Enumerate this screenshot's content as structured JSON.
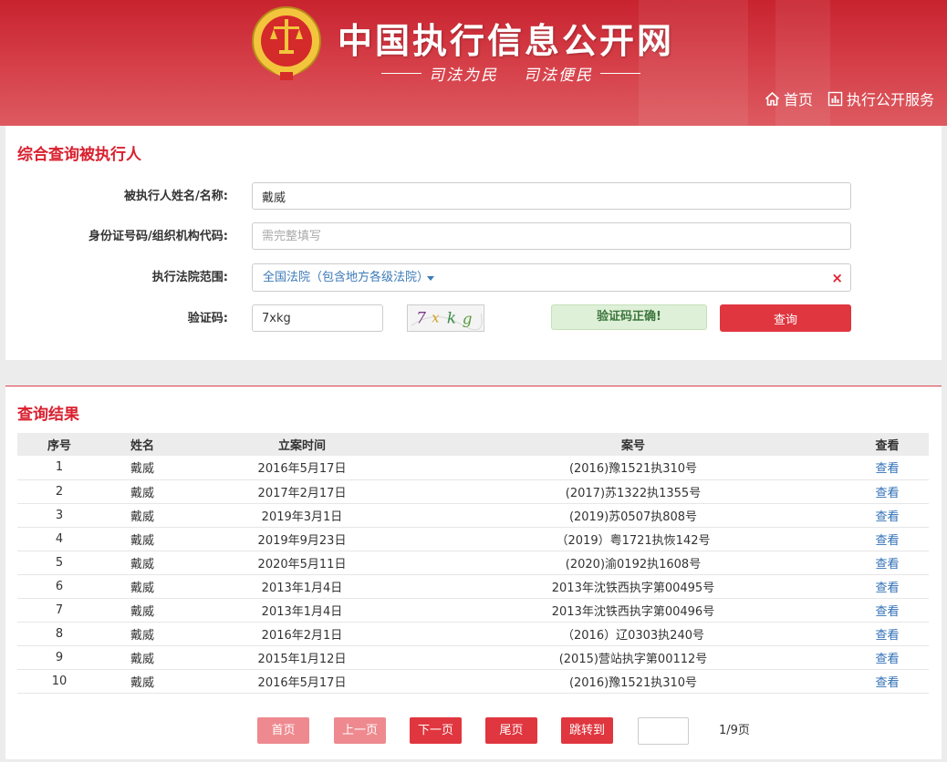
{
  "header": {
    "site_title": "中国执行信息公开网",
    "slogan_left": "司法为民",
    "slogan_right": "司法便民",
    "nav": [
      {
        "label": "首页",
        "icon": "home-icon"
      },
      {
        "label": "执行公开服务",
        "icon": "bar-chart-icon"
      }
    ]
  },
  "search_panel": {
    "title": "综合查询被执行人",
    "fields": {
      "name_label": "被执行人姓名/名称:",
      "name_value": "戴威",
      "id_label": "身份证号码/组织机构代码:",
      "id_placeholder": "需完整填写",
      "court_label": "执行法院范围:",
      "court_value": "全国法院（包含地方各级法院）",
      "captcha_label": "验证码:",
      "captcha_value": "7xkg",
      "captcha_image_text": "7xkg",
      "captcha_status": "验证码正确!",
      "submit_label": "查询"
    }
  },
  "results_panel": {
    "title": "查询结果",
    "columns": [
      "序号",
      "姓名",
      "立案时间",
      "案号",
      "查看"
    ],
    "rows": [
      {
        "no": "1",
        "name": "戴威",
        "date": "2016年5月17日",
        "case": "(2016)豫1521执310号",
        "view": "查看"
      },
      {
        "no": "2",
        "name": "戴威",
        "date": "2017年2月17日",
        "case": "(2017)苏1322执1355号",
        "view": "查看"
      },
      {
        "no": "3",
        "name": "戴威",
        "date": "2019年3月1日",
        "case": "(2019)苏0507执808号",
        "view": "查看"
      },
      {
        "no": "4",
        "name": "戴威",
        "date": "2019年9月23日",
        "case": "（2019）粤1721执恢142号",
        "view": "查看"
      },
      {
        "no": "5",
        "name": "戴威",
        "date": "2020年5月11日",
        "case": "(2020)渝0192执1608号",
        "view": "查看"
      },
      {
        "no": "6",
        "name": "戴威",
        "date": "2013年1月4日",
        "case": "2013年沈铁西执字第00495号",
        "view": "查看"
      },
      {
        "no": "7",
        "name": "戴威",
        "date": "2013年1月4日",
        "case": "2013年沈铁西执字第00496号",
        "view": "查看"
      },
      {
        "no": "8",
        "name": "戴威",
        "date": "2016年2月1日",
        "case": "（2016）辽0303执240号",
        "view": "查看"
      },
      {
        "no": "9",
        "name": "戴威",
        "date": "2015年1月12日",
        "case": "(2015)营站执字第00112号",
        "view": "查看"
      },
      {
        "no": "10",
        "name": "戴威",
        "date": "2016年5月17日",
        "case": "(2016)豫1521执310号",
        "view": "查看"
      }
    ],
    "pagination": {
      "first": "首页",
      "prev": "上一页",
      "next": "下一页",
      "last": "尾页",
      "jump": "跳转到",
      "jump_value": "",
      "page_info": "1/9页"
    }
  },
  "colors": {
    "brand_red": "#d9202e",
    "button_red": "#e0363f",
    "disabled_red": "#ee8a8f",
    "link_blue": "#2f6fb5",
    "success_green_bg": "#dff0d8"
  }
}
